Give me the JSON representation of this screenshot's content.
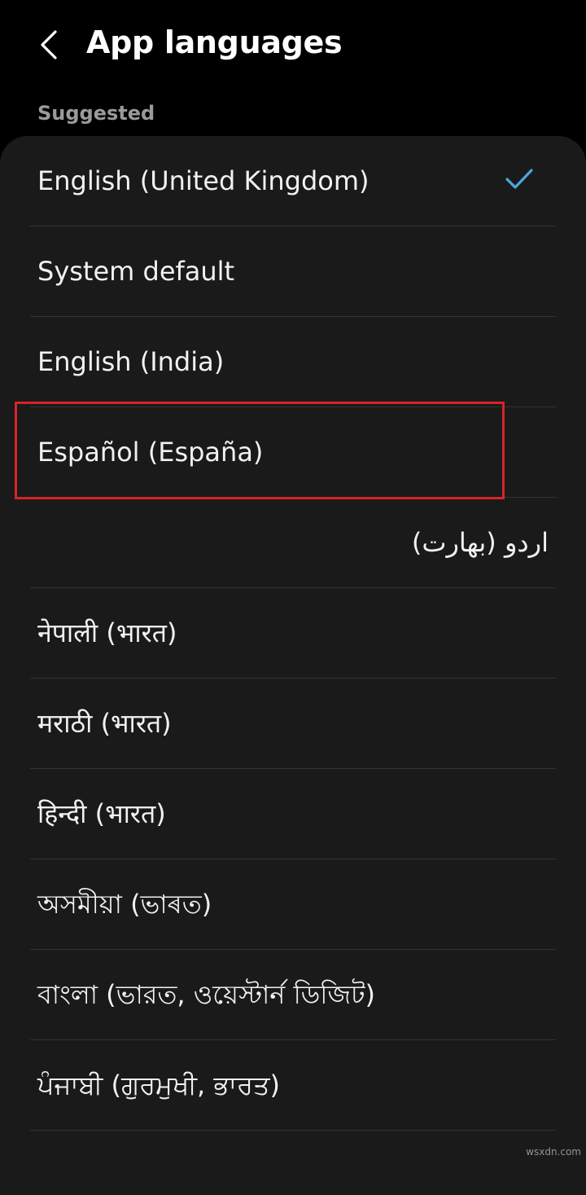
{
  "header": {
    "back_icon": "chevron-left-icon",
    "title": "App languages"
  },
  "section": {
    "label": "Suggested"
  },
  "languages": [
    {
      "label": "English (United Kingdom)",
      "selected": true
    },
    {
      "label": "System default",
      "selected": false
    },
    {
      "label": "English (India)",
      "selected": false
    },
    {
      "label": "Español (España)",
      "selected": false,
      "highlighted": true
    },
    {
      "label": "اردو (بھارت)",
      "selected": false,
      "rtl": true
    },
    {
      "label": "नेपाली (भारत)",
      "selected": false
    },
    {
      "label": "मराठी (भारत)",
      "selected": false
    },
    {
      "label": "हिन्दी (भारत)",
      "selected": false
    },
    {
      "label": "অসমীয়া (ভাৰত)",
      "selected": false
    },
    {
      "label": "বাংলা (ভারত, ওয়েস্টার্ন ডিজিট)",
      "selected": false
    },
    {
      "label": "ਪੰਜਾਬੀ (ਗੁਰਮੁਖੀ, ਭਾਰਤ)",
      "selected": false
    }
  ],
  "colors": {
    "background": "#000000",
    "card": "#1a1a1a",
    "check_accent": "#4ea6dc",
    "highlight": "#d8232a",
    "secondary_text": "#9a9a9a"
  },
  "watermark": "wsxdn.com"
}
